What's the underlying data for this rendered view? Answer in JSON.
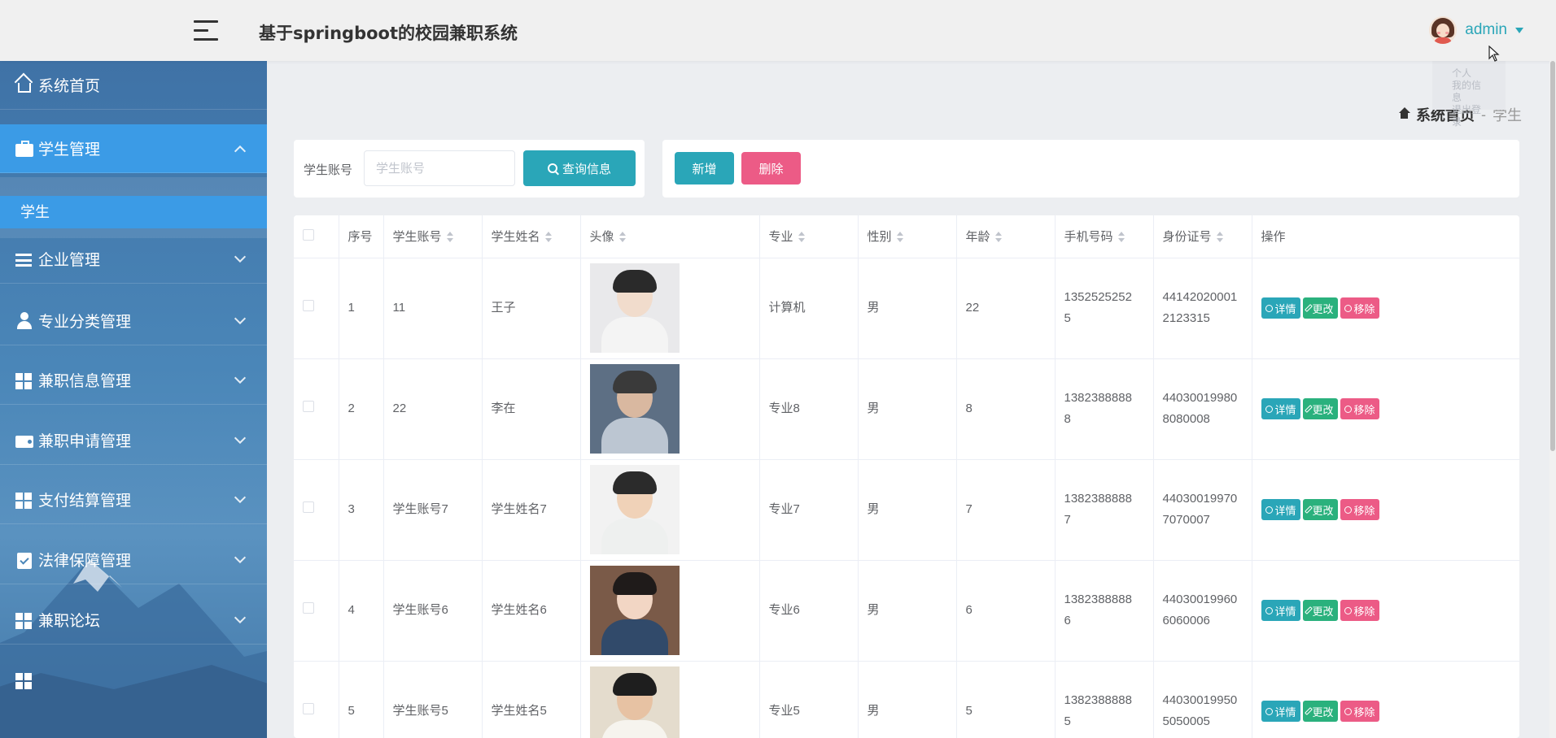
{
  "header": {
    "title": "基于springboot的校园兼职系统",
    "username": "admin"
  },
  "dropdown_ghost": [
    "个人",
    "我的信息",
    "退出登录"
  ],
  "sidebar": {
    "items": [
      {
        "label": "系统首页",
        "icon": "home-icon"
      },
      {
        "label": "学生管理",
        "icon": "briefcase-icon",
        "expanded": true
      },
      {
        "label": "企业管理",
        "icon": "bars-icon"
      },
      {
        "label": "专业分类管理",
        "icon": "person-icon"
      },
      {
        "label": "兼职信息管理",
        "icon": "grid-icon"
      },
      {
        "label": "兼职申请管理",
        "icon": "wallet-icon"
      },
      {
        "label": "支付结算管理",
        "icon": "grid-icon"
      },
      {
        "label": "法律保障管理",
        "icon": "clipboard-icon"
      },
      {
        "label": "兼职论坛",
        "icon": "grid-icon"
      }
    ],
    "subitem": "学生"
  },
  "breadcrumb": {
    "root": "系统首页",
    "separator": "-",
    "current": "学生"
  },
  "search": {
    "label": "学生账号",
    "placeholder": "学生账号",
    "button": "查询信息"
  },
  "actions": {
    "add": "新增",
    "delete": "删除"
  },
  "table": {
    "headers": [
      "序号",
      "学生账号",
      "学生姓名",
      "头像",
      "专业",
      "性别",
      "年龄",
      "手机号码",
      "身份证号",
      "操作"
    ],
    "rows": [
      {
        "no": "1",
        "account": "11",
        "name": "王子",
        "major": "计算机",
        "gender": "男",
        "age": "22",
        "phone": "13525252525",
        "idcard": "441420200012123315"
      },
      {
        "no": "2",
        "account": "22",
        "name": "李在",
        "major": "专业8",
        "gender": "男",
        "age": "8",
        "phone": "13823888888",
        "idcard": "440300199808080008"
      },
      {
        "no": "3",
        "account": "学生账号7",
        "name": "学生姓名7",
        "major": "专业7",
        "gender": "男",
        "age": "7",
        "phone": "13823888887",
        "idcard": "440300199707070007"
      },
      {
        "no": "4",
        "account": "学生账号6",
        "name": "学生姓名6",
        "major": "专业6",
        "gender": "男",
        "age": "6",
        "phone": "13823888886",
        "idcard": "440300199606060006"
      },
      {
        "no": "5",
        "account": "学生账号5",
        "name": "学生姓名5",
        "major": "专业5",
        "gender": "男",
        "age": "5",
        "phone": "13823888885",
        "idcard": "440300199505050005"
      }
    ],
    "ops": {
      "detail": "详情",
      "edit": "更改",
      "remove": "移除"
    }
  },
  "colors": {
    "primary": "#2aa6b8",
    "danger": "#ec5b86",
    "success": "#2ab17d",
    "sidebar_active": "#3b9be6"
  }
}
